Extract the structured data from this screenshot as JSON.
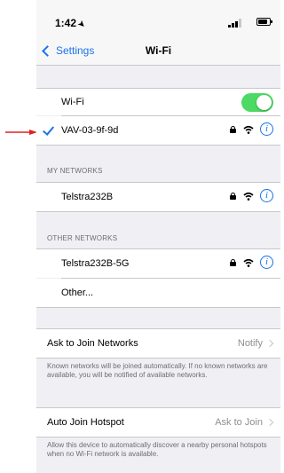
{
  "status_bar": {
    "time": "1:42",
    "location_arrow": "➤"
  },
  "nav": {
    "back_label": "Settings",
    "title": "Wi-Fi"
  },
  "wifi_toggle": {
    "label": "Wi-Fi",
    "on": true
  },
  "connected_network": {
    "name": "VAV-03-9f-9d",
    "info": "i"
  },
  "my_networks": {
    "header": "MY NETWORKS",
    "items": [
      {
        "name": "Telstra232B",
        "info": "i"
      }
    ]
  },
  "other_networks": {
    "header": "OTHER NETWORKS",
    "items": [
      {
        "name": "Telstra232B-5G",
        "info": "i"
      }
    ],
    "other_label": "Other..."
  },
  "ask_to_join": {
    "label": "Ask to Join Networks",
    "value": "Notify",
    "footer": "Known networks will be joined automatically. If no known networks are available, you will be notified of available networks."
  },
  "auto_join_hotspot": {
    "label": "Auto Join Hotspot",
    "value": "Ask to Join",
    "footer": "Allow this device to automatically discover a nearby personal hotspots when no Wi-Fi network is available."
  },
  "colors": {
    "accent": "#1a73e8",
    "toggle_on": "#4cd964",
    "pointer_arrow": "#e02020",
    "background": "#efeff4"
  }
}
